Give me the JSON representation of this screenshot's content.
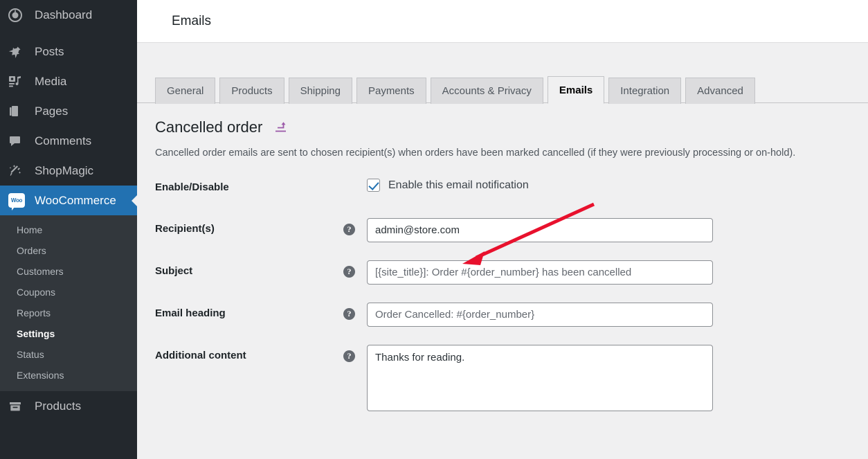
{
  "sidebar": {
    "items": [
      {
        "label": "Dashboard",
        "icon": "dashboard-icon"
      },
      {
        "label": "Posts",
        "icon": "pin-icon"
      },
      {
        "label": "Media",
        "icon": "media-icon"
      },
      {
        "label": "Pages",
        "icon": "pages-icon"
      },
      {
        "label": "Comments",
        "icon": "comment-icon"
      },
      {
        "label": "ShopMagic",
        "icon": "magic-wand-icon"
      },
      {
        "label": "WooCommerce",
        "icon": "woo-icon",
        "current": true
      },
      {
        "label": "Products",
        "icon": "products-icon"
      }
    ],
    "woo_badge_text": "Woo",
    "submenu": [
      {
        "label": "Home"
      },
      {
        "label": "Orders"
      },
      {
        "label": "Customers"
      },
      {
        "label": "Coupons"
      },
      {
        "label": "Reports"
      },
      {
        "label": "Settings",
        "active": true
      },
      {
        "label": "Status"
      },
      {
        "label": "Extensions"
      }
    ]
  },
  "header": {
    "title": "Emails"
  },
  "tabs": [
    {
      "label": "General"
    },
    {
      "label": "Products"
    },
    {
      "label": "Shipping"
    },
    {
      "label": "Payments"
    },
    {
      "label": "Accounts & Privacy"
    },
    {
      "label": "Emails",
      "active": true
    },
    {
      "label": "Integration"
    },
    {
      "label": "Advanced"
    }
  ],
  "section": {
    "title": "Cancelled order",
    "back_icon": "return-arrow-icon",
    "description": "Cancelled order emails are sent to chosen recipient(s) when orders have been marked cancelled (if they were previously processing or on-hold)."
  },
  "form": {
    "enable": {
      "label": "Enable/Disable",
      "checkbox_label": "Enable this email notification",
      "checked": true
    },
    "recipients": {
      "label": "Recipient(s)",
      "value": "admin@store.com",
      "placeholder": ""
    },
    "subject": {
      "label": "Subject",
      "value": "",
      "placeholder": "[{site_title}]: Order #{order_number} has been cancelled"
    },
    "email_heading": {
      "label": "Email heading",
      "value": "",
      "placeholder": "Order Cancelled: #{order_number}"
    },
    "additional_content": {
      "label": "Additional content",
      "value": "Thanks for reading.",
      "placeholder": ""
    },
    "help_icon_glyph": "?"
  },
  "annotation": {
    "arrow_color": "#e8112d",
    "name": "red-arrow-pointing-to-recipients-field"
  },
  "colors": {
    "sidebar_bg": "#23282d",
    "submenu_bg": "#32373c",
    "accent": "#2271b1",
    "content_bg": "#f0f0f1",
    "back_icon": "#9b59a8"
  }
}
